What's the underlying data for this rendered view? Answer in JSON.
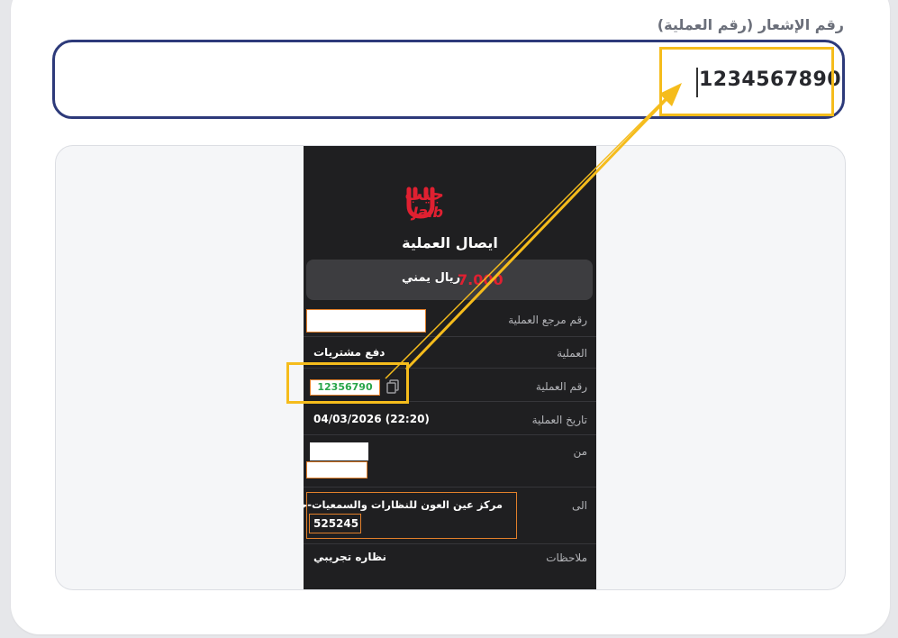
{
  "notification": {
    "label": "رقم الإشعار (رقم العملية)",
    "value": "1234567890"
  },
  "receipt": {
    "brand": "Jaib",
    "brand_ar": "جيب",
    "title": "ايصال العملية",
    "amount": "7.000",
    "currency": "ريال يمني",
    "rows": {
      "reference_label": "رقم مرجع العملية",
      "operation_label": "العملية",
      "operation_value": "دفع مشتريات",
      "txn_label": "رقم العملية",
      "txn_value": "12356790",
      "date_label": "تاريخ العملية",
      "date_value": "04/03/2026 (22:20)",
      "from_label": "من",
      "to_label": "الى",
      "to_value": "مركز عين العون للنظارات والسمعيات-حده",
      "to_code": "525245",
      "notes_label": "ملاحظات",
      "notes_value": "نظاره تجريبي"
    }
  },
  "colors": {
    "input_border": "#2d3a7a",
    "highlight": "#f5bc1c",
    "brand_red": "#e02031",
    "receipt_bg": "#1f1f21",
    "txn_green": "#2aa54a",
    "mask_border": "#e2802b"
  }
}
